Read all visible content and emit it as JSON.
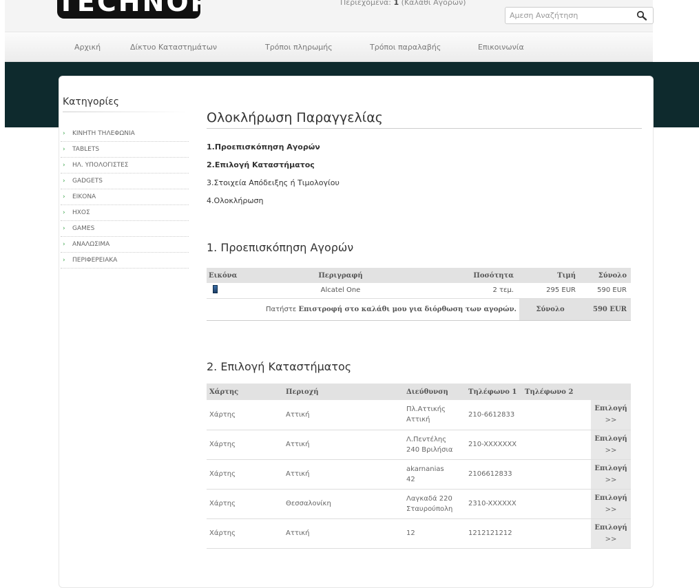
{
  "header": {
    "logo_text": "TECHNOPOLIS",
    "cart_label": "Περιεχόμενα:",
    "cart_count": "1",
    "cart_suffix": "(Καλάθι Αγορών)",
    "search_placeholder": "Αμεση Αναζήτηση"
  },
  "nav": {
    "items": [
      "Αρχική",
      "Δίκτυο Καταστημάτων",
      "Τρόποι πληρωμής",
      "Τρόποι παραλαβής",
      "Επικοινωνία"
    ]
  },
  "sidebar": {
    "title": "Κατηγορίες",
    "items": [
      "ΚΙΝΗΤΗ ΤΗΛΕΦΩΝΙΑ",
      "TABLETS",
      "ΗΛ. ΥΠΟΛΟΓΙΣΤΕΣ",
      "GADGETS",
      "ΕΙΚΟΝΑ",
      "ΗΧΟΣ",
      "GAMES",
      "ΑΝΑΛΩΣΙΜΑ",
      "ΠΕΡΙΦΕΡΕΙΑΚΑ"
    ]
  },
  "main": {
    "title": "Ολοκλήρωση Παραγγελίας",
    "steps": [
      "1.Προεπισκόπηση Αγορών",
      "2.Επιλογή Καταστήματος",
      "3.Στοιχεία Απόδειξης ή Τιμολογίου",
      "4.Ολοκλήρωση"
    ]
  },
  "preview": {
    "title": "1. Προεπισκόπηση Αγορών",
    "headers": [
      "Εικόνα",
      "Περιγραφή",
      "Ποσότητα",
      "Τιμή",
      "Σύνολο"
    ],
    "row": {
      "description": "Alcatel One",
      "quantity": "2 τεμ.",
      "price": "295 EUR",
      "total": "590 EUR"
    },
    "note_prefix": "Πατήστε",
    "note_bold": "Επιστροφή στο καλάθι μου για διόρθωση των αγορών.",
    "total_label": "Σύνολο",
    "total_value": "590 EUR"
  },
  "stores": {
    "title": "2. Επιλογή Καταστήματος",
    "headers": [
      "Χάρτης",
      "Περιοχή",
      "Διεύθυνση",
      "Τηλέφωνο 1",
      "Τηλέφωνο 2"
    ],
    "select_label": "Επιλογή",
    "select_arrows": ">>",
    "rows": [
      {
        "map": "Χάρτης",
        "region": "Αττική",
        "address_1": "Πλ.Αττικής",
        "address_2": "Αττική",
        "phone1": "210-6612833",
        "phone2": ""
      },
      {
        "map": "Χάρτης",
        "region": "Αττική",
        "address_1": "Λ.Πεντέλης",
        "address_2": "240 Βριλήσια",
        "phone1": "210-XXXXXXX",
        "phone2": ""
      },
      {
        "map": "Χάρτης",
        "region": "Αττική",
        "address_1": "akarnanias",
        "address_2": "42",
        "phone1": "2106612833",
        "phone2": ""
      },
      {
        "map": "Χάρτης",
        "region": "Θεσσαλονίκη",
        "address_1": "Λαγκαδά 220",
        "address_2": "Σταυρούπολη",
        "phone1": "2310-XXXXXX",
        "phone2": ""
      },
      {
        "map": "Χάρτης",
        "region": "Αττική",
        "address_1": "12",
        "address_2": "",
        "phone1": "1212121212",
        "phone2": ""
      }
    ]
  }
}
